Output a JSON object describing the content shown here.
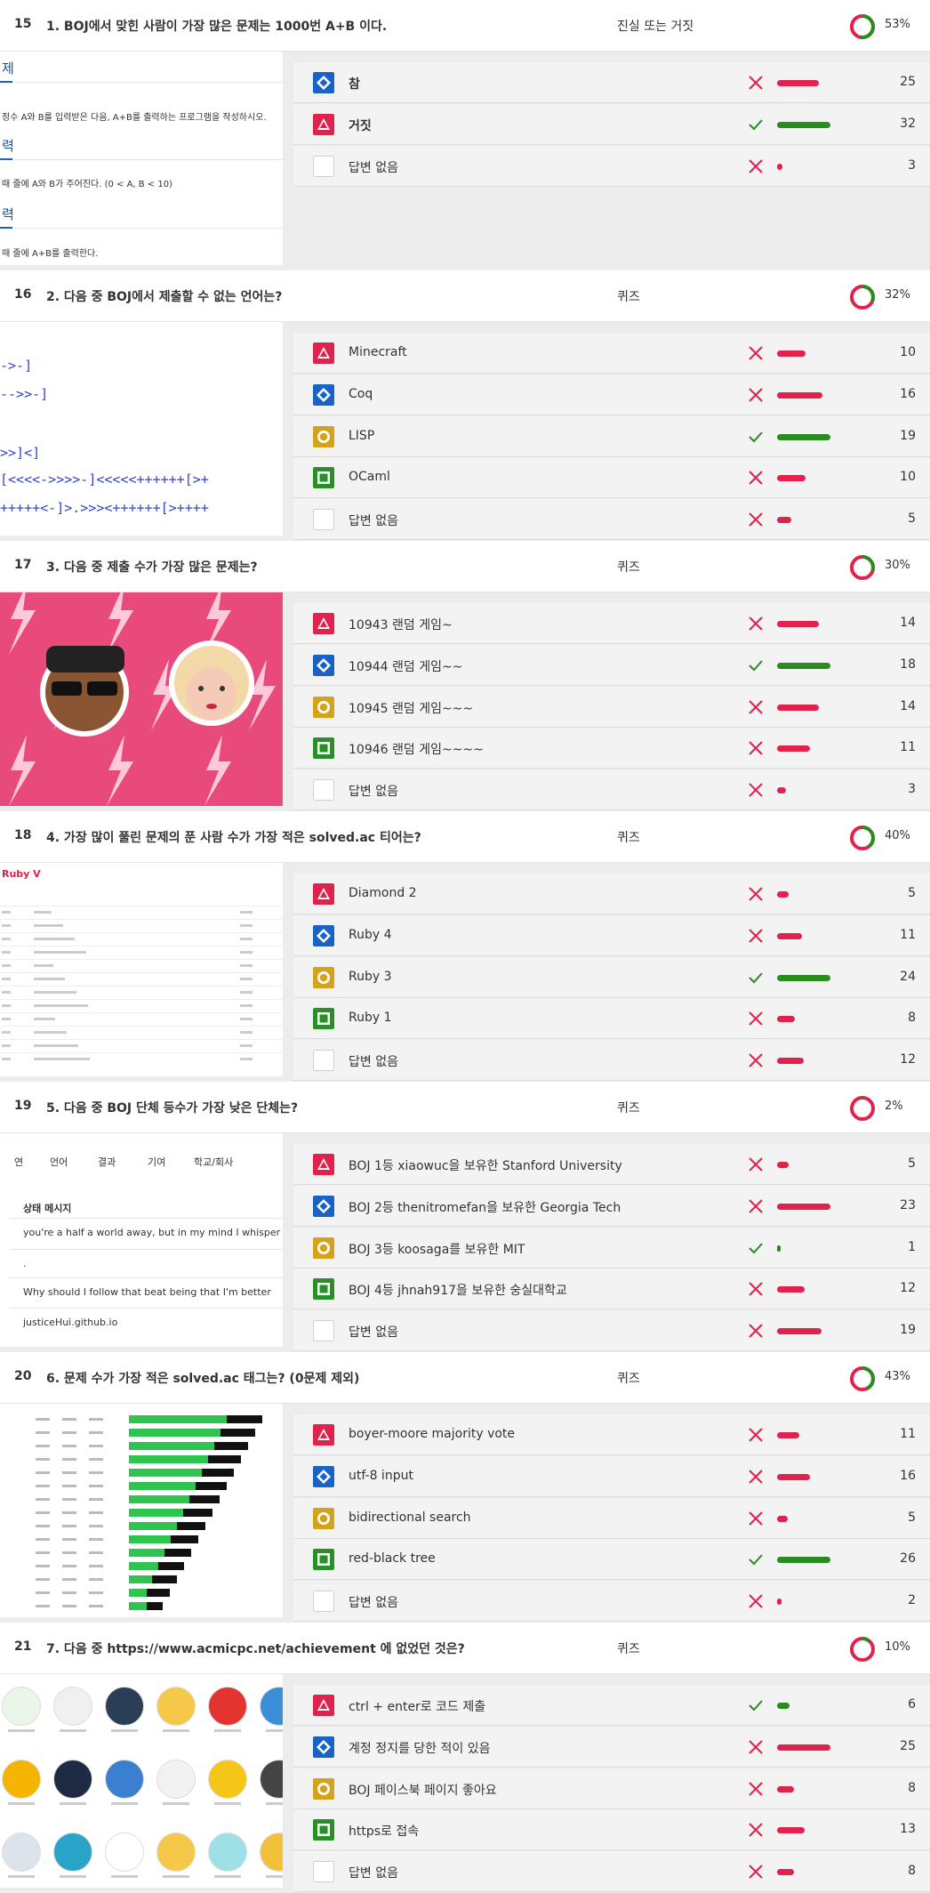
{
  "colors": {
    "red": "#e0224d",
    "green": "#2a8c1e",
    "blue": "#1a63c6",
    "gold": "#d4a21b",
    "box_green": "#279127"
  },
  "q15": {
    "num": "15",
    "title": "1. BOJ에서 맞힌 사람이 가장 많은 문제는 1000번 A+B 이다.",
    "type": "진실 또는 거짓",
    "pct": "53%",
    "pct_value": 0.53,
    "preview": {
      "h1": "제",
      "t1": "정수 A와 B를 입력받은 다음, A+B를 출력하는 프로그램을 작성하시오.",
      "h2": "력",
      "t2": "때 줄에 A와 B가 주어진다. (0 < A, B < 10)",
      "h3": "력",
      "t3": "때 줄에 A+B를 출력한다."
    },
    "answers": [
      {
        "shape": "diamond",
        "label": "참",
        "bold": true,
        "correct": false,
        "count": "25",
        "value": 25
      },
      {
        "shape": "triangle",
        "label": "거짓",
        "bold": true,
        "correct": true,
        "count": "32",
        "value": 32
      },
      {
        "shape": "none",
        "label": "답변 없음",
        "correct": false,
        "count": "3",
        "value": 3
      }
    ]
  },
  "q16": {
    "num": "16",
    "title": "2. 다음 중 BOJ에서 제출할 수 없는 언어는?",
    "type": "퀴즈",
    "pct": "32%",
    "pct_value": 0.32,
    "preview": {
      "l1": "->-]",
      "l2": "-->>-]",
      "l3": ">>]<]",
      "l4": "[<<<<->>>>-]<<<<<++++++[>+",
      "l5": "+++++<-]>.>>><++++++[>++++"
    },
    "answers": [
      {
        "shape": "triangle",
        "label": "Minecraft",
        "correct": false,
        "count": "10",
        "value": 10
      },
      {
        "shape": "diamond",
        "label": "Coq",
        "correct": false,
        "count": "16",
        "value": 16
      },
      {
        "shape": "circle",
        "label": "LISP",
        "correct": true,
        "count": "19",
        "value": 19
      },
      {
        "shape": "square",
        "label": "OCaml",
        "correct": false,
        "count": "10",
        "value": 10
      },
      {
        "shape": "none",
        "label": "답변 없음",
        "correct": false,
        "count": "5",
        "value": 5
      }
    ]
  },
  "q17": {
    "num": "17",
    "title": "3. 다음 중 제출 수가 가장 많은 문제는?",
    "type": "퀴즈",
    "pct": "30%",
    "pct_value": 0.3,
    "answers": [
      {
        "shape": "triangle",
        "label": "10943 랜덤 게임~",
        "correct": false,
        "count": "14",
        "value": 14
      },
      {
        "shape": "diamond",
        "label": "10944 랜덤 게임~~",
        "correct": true,
        "count": "18",
        "value": 18
      },
      {
        "shape": "circle",
        "label": "10945 랜덤 게임~~~",
        "correct": false,
        "count": "14",
        "value": 14
      },
      {
        "shape": "square",
        "label": "10946 랜덤 게임~~~~",
        "correct": false,
        "count": "11",
        "value": 11
      },
      {
        "shape": "none",
        "label": "답변 없음",
        "correct": false,
        "count": "3",
        "value": 3
      }
    ]
  },
  "q18": {
    "num": "18",
    "title": "4. 가장 많이 풀린 문제의 푼 사람 수가 가장 적은 solved.ac 티어는?",
    "type": "퀴즈",
    "pct": "40%",
    "pct_value": 0.4,
    "preview": {
      "tier": "Ruby V"
    },
    "answers": [
      {
        "shape": "triangle",
        "label": "Diamond 2",
        "correct": false,
        "count": "5",
        "value": 5
      },
      {
        "shape": "diamond",
        "label": "Ruby 4",
        "correct": false,
        "count": "11",
        "value": 11
      },
      {
        "shape": "circle",
        "label": "Ruby 3",
        "correct": true,
        "count": "24",
        "value": 24
      },
      {
        "shape": "square",
        "label": "Ruby 1",
        "correct": false,
        "count": "8",
        "value": 8
      },
      {
        "shape": "none",
        "label": "답변 없음",
        "correct": false,
        "count": "12",
        "value": 12
      }
    ]
  },
  "q19": {
    "num": "19",
    "title": "5. 다음 중 BOJ 단체 등수가 가장 낮은 단체는?",
    "type": "퀴즈",
    "pct": "2%",
    "pct_value": 0.02,
    "preview": {
      "tabs": [
        "연",
        "언어",
        "결과",
        "기여",
        "학교/회사"
      ],
      "status_header": "상태 메시지",
      "r1": "you're a half a world away, but in my mind I whisper",
      "r2": ".",
      "r3": "Why should I follow that beat being that I'm better",
      "r4": "justiceHui.github.io"
    },
    "answers": [
      {
        "shape": "triangle",
        "label": "BOJ 1등 xiaowuc을 보유한 Stanford University",
        "correct": false,
        "count": "5",
        "value": 5
      },
      {
        "shape": "diamond",
        "label": "BOJ 2등 thenitromefan을 보유한 Georgia Tech",
        "correct": false,
        "count": "23",
        "value": 23
      },
      {
        "shape": "circle",
        "label": "BOJ 3등 koosaga를 보유한 MIT",
        "correct": true,
        "count": "1",
        "value": 1
      },
      {
        "shape": "square",
        "label": "BOJ 4등 jhnah917을 보유한 숭실대학교",
        "correct": false,
        "count": "12",
        "value": 12
      },
      {
        "shape": "none",
        "label": "답변 없음",
        "correct": false,
        "count": "19",
        "value": 19
      }
    ]
  },
  "q20": {
    "num": "20",
    "title": "6. 문제 수가 가장 적은 solved.ac 태그는? (0문제 제외)",
    "type": "퀴즈",
    "pct": "43%",
    "pct_value": 0.43,
    "answers": [
      {
        "shape": "triangle",
        "label": "boyer-moore majority vote",
        "correct": false,
        "count": "11",
        "value": 11
      },
      {
        "shape": "diamond",
        "label": "utf-8 input",
        "correct": false,
        "count": "16",
        "value": 16
      },
      {
        "shape": "circle",
        "label": "bidirectional search",
        "correct": false,
        "count": "5",
        "value": 5
      },
      {
        "shape": "square",
        "label": "red-black tree",
        "correct": true,
        "count": "26",
        "value": 26
      },
      {
        "shape": "none",
        "label": "답변 없음",
        "correct": false,
        "count": "2",
        "value": 2
      }
    ]
  },
  "q21": {
    "num": "21",
    "title": "7. 다음 중 https://www.acmicpc.net/achievement 에 없었던 것은?",
    "type": "퀴즈",
    "pct": "10%",
    "pct_value": 0.1,
    "answers": [
      {
        "shape": "triangle",
        "label": "ctrl + enter로 코드 제출",
        "correct": true,
        "count": "6",
        "value": 6
      },
      {
        "shape": "diamond",
        "label": "계정 정지를 당한 적이 있음",
        "correct": false,
        "count": "25",
        "value": 25
      },
      {
        "shape": "circle",
        "label": "BOJ 페이스북 페이지 좋아요",
        "correct": false,
        "count": "8",
        "value": 8
      },
      {
        "shape": "square",
        "label": "https로 접속",
        "correct": false,
        "count": "13",
        "value": 13
      },
      {
        "shape": "none",
        "label": "답변 없음",
        "correct": false,
        "count": "8",
        "value": 8
      }
    ]
  }
}
